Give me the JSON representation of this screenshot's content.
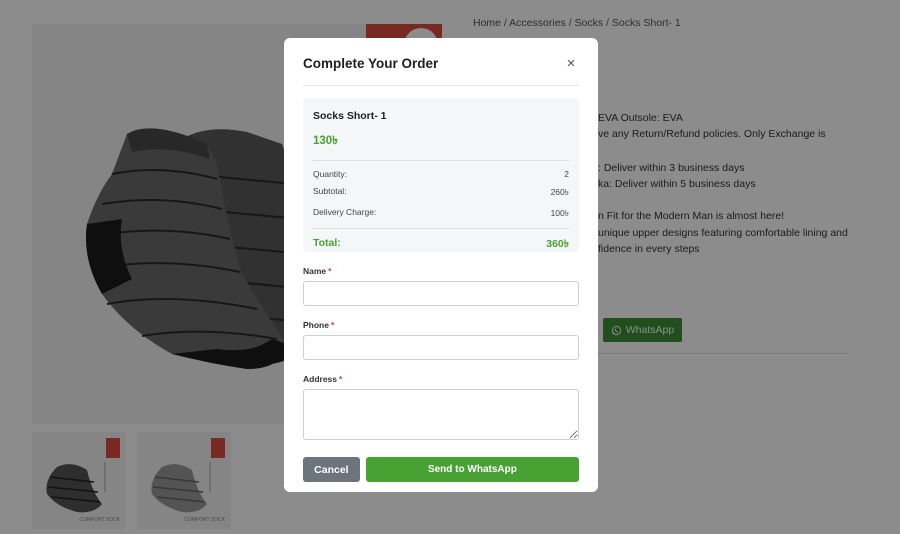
{
  "page": {
    "breadcrumb": "Home / Accessories / Socks / Socks Short- 1",
    "description_lines": [
      "EVA Outsole: EVA",
      "ve any Return/Refund policies. Only Exchange is",
      ": Deliver within 3 business days",
      "ka: Deliver within 5 business days",
      "n Fit for the Modern Man is almost here!",
      "unique upper designs featuring comfortable lining and",
      "fidence in every steps"
    ],
    "whatsapp_label": "WhatsApp",
    "thumb_brand": "COMFORT SOCK"
  },
  "modal": {
    "title": "Complete Your Order",
    "close_glyph": "×",
    "product_name": "Socks Short- 1",
    "product_price": "130৳",
    "rows": [
      {
        "label": "Quantity:",
        "value": "2"
      },
      {
        "label": "Subtotal:",
        "value": "260৳"
      },
      {
        "label": "Delivery Charge:",
        "value": "100৳"
      }
    ],
    "total_label": "Total:",
    "total_value": "360৳",
    "fields": {
      "name_label": "Name",
      "phone_label": "Phone",
      "address_label": "Address",
      "required_mark": "*"
    },
    "cancel_label": "Cancel",
    "send_label": "Send to WhatsApp"
  },
  "colors": {
    "accent_green": "#47a233",
    "cancel_gray": "#6c757d",
    "whatsapp_green": "#3f8f36"
  }
}
